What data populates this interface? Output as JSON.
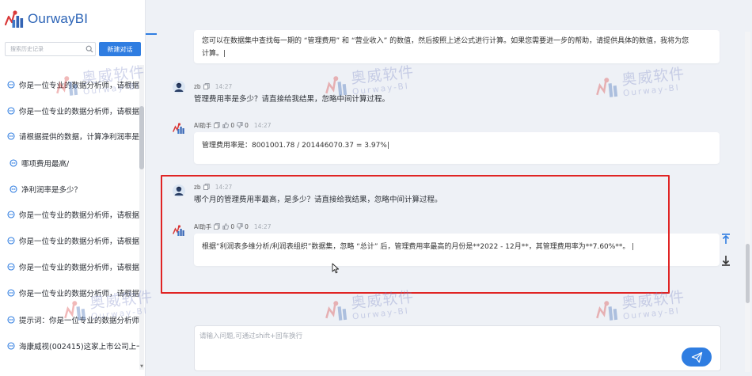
{
  "app": {
    "logo_text": "OurwayBI"
  },
  "sidebar": {
    "search_placeholder": "搜索历史记录",
    "new_chat_label": "新建对话",
    "history": [
      {
        "icon": "chat-icon",
        "label": "你是一位专业的数据分析师，请根据"
      },
      {
        "icon": "chat-icon",
        "label": "你是一位专业的数据分析师，请根据"
      },
      {
        "icon": "chat-icon",
        "label": "请根据提供的数据，计算净利润率是"
      },
      {
        "icon": "chat-icon",
        "label": "哪项费用最高/"
      },
      {
        "icon": "chat-icon",
        "label": "净利润率是多少？"
      },
      {
        "icon": "chat-icon",
        "label": "你是一位专业的数据分析师，请根据"
      },
      {
        "icon": "chat-icon",
        "label": "你是一位专业的数据分析师，请根据"
      },
      {
        "icon": "chat-icon",
        "label": "你是一位专业的数据分析师，请根据"
      },
      {
        "icon": "chat-icon",
        "label": "你是一位专业的数据分析师，请根据"
      },
      {
        "icon": "chat-icon",
        "label": "提示词：你是一位专业的数据分析师"
      },
      {
        "icon": "chat-icon",
        "label": "海康威视(002415)这家上市公司上一"
      }
    ]
  },
  "chat": {
    "msg0": {
      "line1": "您可以在数据集中查找每一期的 “管理费用” 和 “营业收入” 的数值，然后按照上述公式进行计算。如果您需要进一步的帮助，请提供具体的数值，我将为您",
      "line2": "计算。|"
    },
    "q1": {
      "user": "zb",
      "time": "14:27",
      "text": "管理费用率是多少？请直接给我结果，忽略中间计算过程。"
    },
    "a1": {
      "user": "AI助手",
      "likes": "0",
      "dislikes": "0",
      "time": "14:27",
      "text": "管理费用率是：8001001.78 / 201446070.37 = 3.97%|"
    },
    "q2": {
      "user": "zb",
      "time": "14:27",
      "text": "哪个月的管理费用率最高，是多少？请直接给我结果，忽略中间计算过程。"
    },
    "a2": {
      "user": "AI助手",
      "likes": "0",
      "dislikes": "0",
      "time": "14:27",
      "text": "根据“利润表多维分析/利润表组织”数据集，忽略 “总计” 后，管理费用率最高的月份是**2022 - 12月**，其管理费用率为**7.60%**。 |"
    },
    "input_placeholder": "请输入问题,可通过shift+回车换行"
  },
  "watermark": {
    "cn": "奥威软件",
    "en": "Ourway-BI"
  },
  "colors": {
    "accent": "#2f7de1",
    "highlight": "#e02424",
    "logo": "#2b63b6"
  }
}
